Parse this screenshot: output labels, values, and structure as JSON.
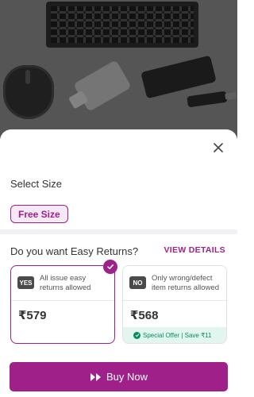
{
  "backdrop": {
    "image_icon": "product-collage-image"
  },
  "sheet": {
    "close_icon": "close-icon",
    "size_title": "Select Size",
    "size_options": [
      {
        "label": "Free Size",
        "selected": true
      }
    ],
    "returns_question": "Do you want Easy Returns?",
    "view_details_label": "VIEW DETAILS",
    "return_options": [
      {
        "tag": "YES",
        "description": "All issue easy returns allowed",
        "price": "₹579",
        "selected": true
      },
      {
        "tag": "NO",
        "description": "Only wrong/defect item returns allowed",
        "price": "₹568",
        "selected": false,
        "offer": "Special Offer | Save ₹11"
      }
    ],
    "buy_now_label": "Buy Now",
    "buy_now_icon": "double-chevron-right-icon"
  },
  "colors": {
    "accent": "#9f2089",
    "offer_green": "#058d5d",
    "offer_bg": "#e2f5ee"
  }
}
